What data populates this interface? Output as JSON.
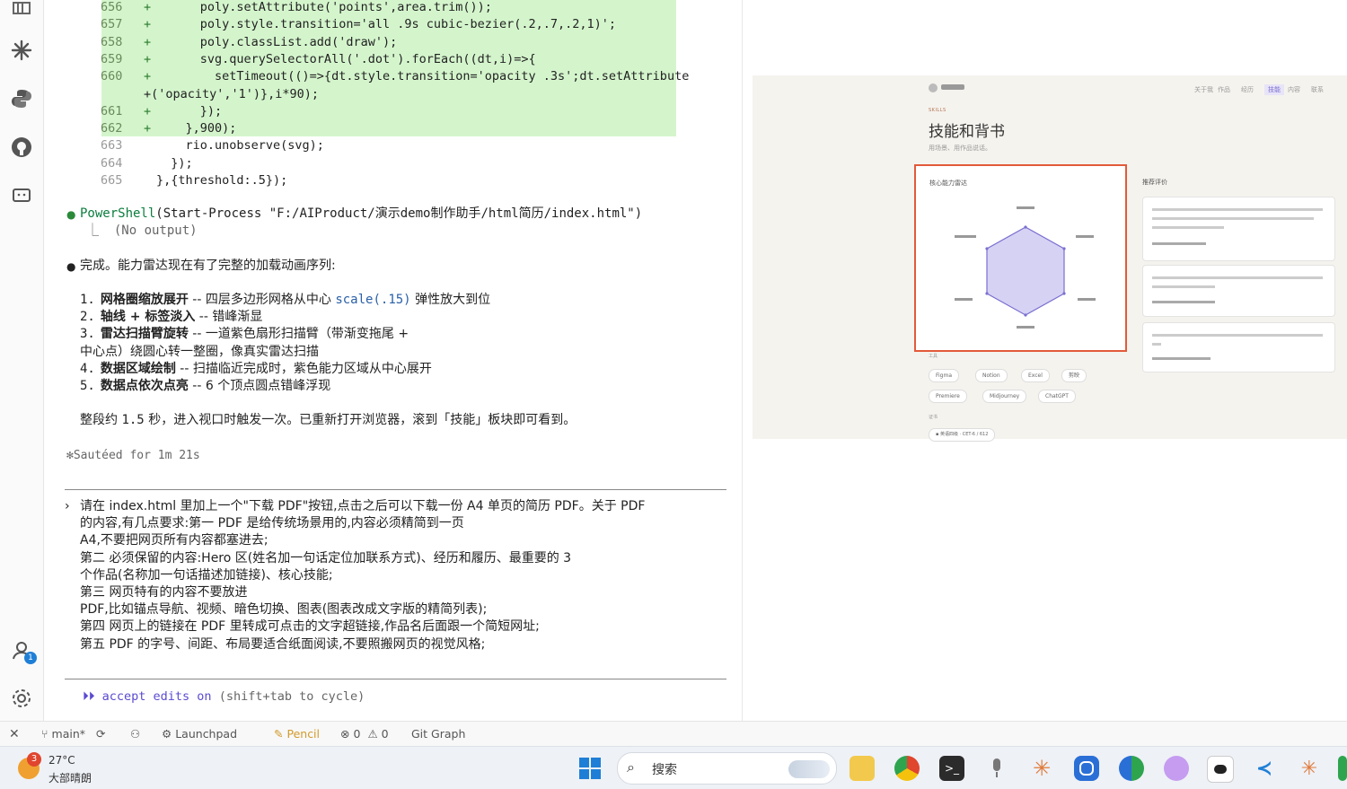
{
  "code": {
    "lines": [
      {
        "num": "656",
        "mark": "+",
        "text": "      poly.setAttribute('points',area.trim());",
        "added": true
      },
      {
        "num": "657",
        "mark": "+",
        "text": "      poly.style.transition='all .9s cubic-bezier(.2,.7,.2,1)';",
        "added": true
      },
      {
        "num": "658",
        "mark": "+",
        "text": "      poly.classList.add('draw');",
        "added": true
      },
      {
        "num": "659",
        "mark": "+",
        "text": "      svg.querySelectorAll('.dot').forEach((dt,i)=>{",
        "added": true
      },
      {
        "num": "660",
        "mark": "+",
        "text": "        setTimeout(()=>{dt.style.transition='opacity .3s';dt.setAttribute",
        "added": true
      },
      {
        "num": "",
        "mark": "",
        "text": "+('opacity','1')},i*90);",
        "added": true
      },
      {
        "num": "661",
        "mark": "+",
        "text": "      });",
        "added": true
      },
      {
        "num": "662",
        "mark": "+",
        "text": "    },900);",
        "added": true
      },
      {
        "num": "663",
        "mark": "",
        "text": "    rio.unobserve(svg);",
        "added": false
      },
      {
        "num": "664",
        "mark": "",
        "text": "  });",
        "added": false
      },
      {
        "num": "665",
        "mark": "",
        "text": "},{threshold:.5});",
        "added": false
      }
    ]
  },
  "tool_call": {
    "name": "PowerShell",
    "args": "(Start-Process \"F:/AIProduct/演示demo制作助手/html简历/index.html\")",
    "result": "(No output)"
  },
  "summary": {
    "intro": "完成。能力雷达现在有了完整的加载动画序列:",
    "steps": [
      {
        "n": "1.",
        "title": "网格圈缩放展开",
        "desc": " -- 四层多边形网格从中心 ",
        "code": "scale(.15)",
        "tail": " 弹性放大到位"
      },
      {
        "n": "2.",
        "title": "轴线 + 标签淡入",
        "desc": " -- 错峰渐显",
        "code": "",
        "tail": ""
      },
      {
        "n": "3.",
        "title": "雷达扫描臂旋转",
        "desc": " -- 一道紫色扇形扫描臂（带渐变拖尾 +",
        "code": "",
        "tail": ""
      },
      {
        "n": "",
        "title": "",
        "desc": "中心点）绕圆心转一整圈，像真实雷达扫描",
        "code": "",
        "tail": ""
      },
      {
        "n": "4.",
        "title": "数据区域绘制",
        "desc": " -- 扫描临近完成时，紫色能力区域从中心展开",
        "code": "",
        "tail": ""
      },
      {
        "n": "5.",
        "title": "数据点依次点亮",
        "desc": " -- 6 个顶点圆点错峰浮现",
        "code": "",
        "tail": ""
      }
    ],
    "footer_a": "整段约 ",
    "footer_code": "1.5",
    "footer_b": " 秒，进入视口时触发一次。已重新打开浏览器，滚到「技能」板块即可看到。",
    "sauteed": "✻Sautéed for 1m 21s"
  },
  "prompt": {
    "lines": [
      "请在 index.html 里加上一个\"下载 PDF\"按钮,点击之后可以下载一份 A4 单页的简历 PDF。关于 PDF",
      "的内容,有几点要求:第一 PDF 是给传统场景用的,内容必须精简到一页",
      "A4,不要把网页所有内容都塞进去;",
      "第二 必须保留的内容:Hero 区(姓名加一句话定位加联系方式)、经历和履历、最重要的 3",
      "个作品(名称加一句话描述加链接)、核心技能;",
      "第三 网页特有的内容不要放进",
      "PDF,比如锚点导航、视频、暗色切换、图表(图表改成文字版的精简列表);",
      "第四 网页上的链接在 PDF 里转成可点击的文字超链接,作品名后面跟一个简短网址;",
      "第五 PDF 的字号、间距、布局要适合纸面阅读,不要照搬网页的视觉风格;"
    ],
    "mode": "accept edits on",
    "mode_hint": "(shift+tab to cycle)"
  },
  "preview": {
    "section_tag": "SKILLS",
    "title": "技能和背书",
    "subtitle": "用场景、用作品说话。",
    "radar_title": "核心能力雷达",
    "recommend_title": "推荐评价",
    "tools_label": "工具",
    "tools": [
      "Figma",
      "Notion",
      "Excel",
      "剪映",
      "Premiere",
      "Midjourney",
      "ChatGPT"
    ],
    "cert_label": "证书",
    "cert_item": "英语四级 · CET-6 / 612",
    "nav": [
      "关于我",
      "作品",
      "经历",
      "技能",
      "内容",
      "联系"
    ]
  },
  "status": {
    "branch": "main*",
    "launchpad": "Launchpad",
    "pencil": "Pencil",
    "errors": "0",
    "warnings": "0",
    "git_graph": "Git Graph"
  },
  "taskbar": {
    "weather_badge": "3",
    "temperature": "27°C",
    "weather_desc": "大部晴朗",
    "search_placeholder": "搜索"
  },
  "account_badge": "1",
  "colors": {
    "added_bg": "#d4f5cc",
    "accent_red": "#e35a3a",
    "radar_purple": "#7a6fd0",
    "vscode_blue": "#1f7fd6"
  }
}
